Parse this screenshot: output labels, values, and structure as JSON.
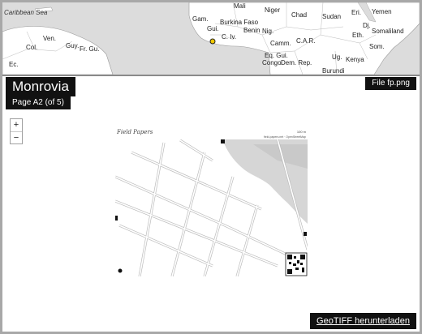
{
  "overview_map": {
    "labels": [
      {
        "text": "Caribbean Sea",
        "style": "sea"
      },
      {
        "text": "Mali"
      },
      {
        "text": "Niger"
      },
      {
        "text": "Chad"
      },
      {
        "text": "Sudan"
      },
      {
        "text": "Eri."
      },
      {
        "text": "Yemen"
      },
      {
        "text": "Gam."
      },
      {
        "text": "Burkina Faso"
      },
      {
        "text": "Gui."
      },
      {
        "text": "Benin"
      },
      {
        "text": "Nig."
      },
      {
        "text": "C. Iv."
      },
      {
        "text": "Dj."
      },
      {
        "text": "Somaliland"
      },
      {
        "text": "Eth."
      },
      {
        "text": "Ven."
      },
      {
        "text": "Col."
      },
      {
        "text": "Guy."
      },
      {
        "text": "Fr. Gu."
      },
      {
        "text": "Ec."
      },
      {
        "text": "Camm."
      },
      {
        "text": "C.A.R."
      },
      {
        "text": "Som."
      },
      {
        "text": "Eq. Gui."
      },
      {
        "text": "Congo"
      },
      {
        "text": "Dem. Rep."
      },
      {
        "text": "Ug."
      },
      {
        "text": "Kenya"
      },
      {
        "text": "Burundi"
      }
    ],
    "marker": "location-marker"
  },
  "header": {
    "title": "Monrovia",
    "subtitle": "Page A2 (of 5)",
    "file_label": "File fp.png"
  },
  "zoom": {
    "in_label": "+",
    "out_label": "−"
  },
  "page": {
    "heading": "Field Papers",
    "scale_text": "100 m",
    "credit_text": "field-papers.net · OpenStreetMap"
  },
  "download": {
    "label": "GeoTIFF herunterladen"
  },
  "colors": {
    "label_bg": "#111111",
    "label_fg": "#ffffff",
    "map_land": "#ffffff",
    "map_sea": "#dcdcdc",
    "marker": "#f0c800"
  }
}
